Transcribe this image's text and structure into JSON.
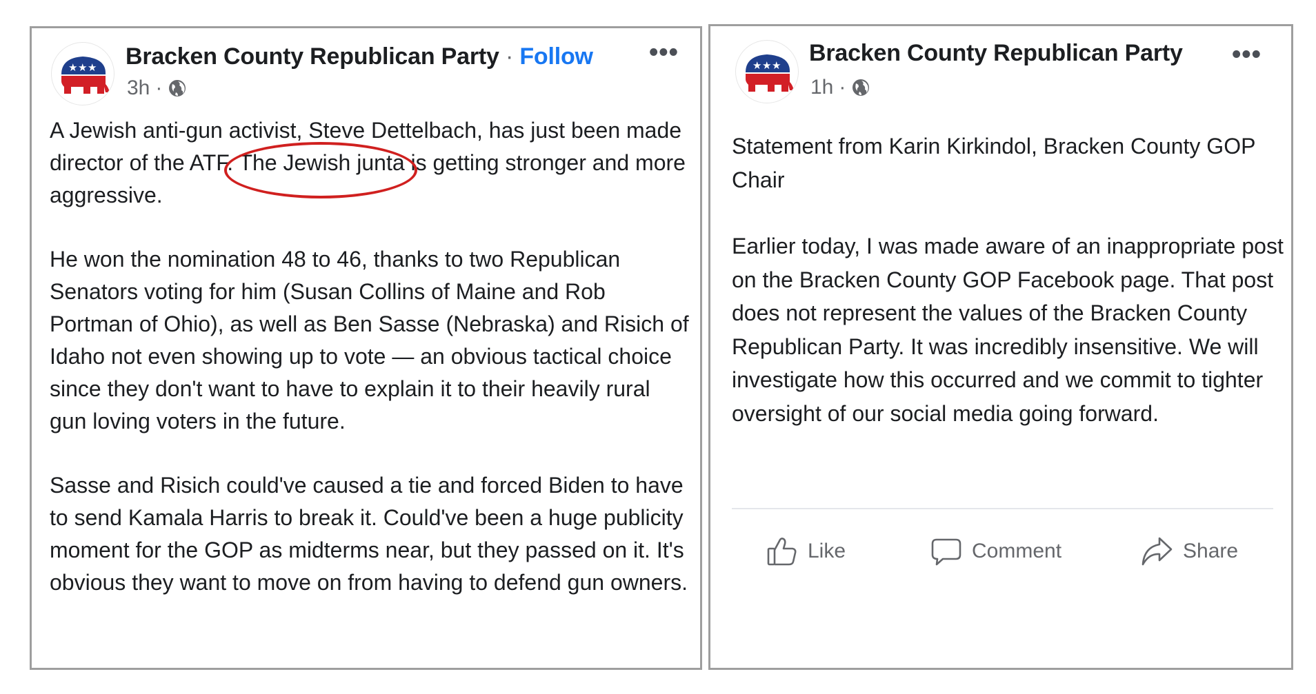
{
  "posts": [
    {
      "page_name": "Bracken County Republican Party",
      "separator": " · ",
      "follow_label": "Follow",
      "time": "3h",
      "meta_separator": "·",
      "more_label": "•••",
      "paragraphs": [
        {
          "before": "A Jewish anti-gun activist, Steve Dettelbach, has just been made director of the ATF.",
          "highlight": "The Jewish junta",
          "after": " is getting stronger and more aggressive."
        },
        {
          "text": "He won the nomination 48 to 46, thanks to two Republican Senators voting for him (Susan Collins of Maine and Rob Portman of Ohio), as well as Ben Sasse (Nebraska) and Risich of Idaho not even showing up to vote — an obvious tactical choice since they don't want to have to explain it to their heavily rural gun loving voters in the future."
        },
        {
          "text": "Sasse and Risich could've caused a tie and forced Biden to have to send Kamala Harris to break it. Could've been a huge publicity moment for the GOP as midterms near, but they passed on it. It's obvious they want to move on from having to defend gun owners."
        }
      ]
    },
    {
      "page_name": "Bracken County Republican Party",
      "time": "1h",
      "meta_separator": "·",
      "more_label": "•••",
      "paragraphs": [
        {
          "text": "Statement from Karin Kirkindol, Bracken County GOP Chair"
        },
        {
          "text": "Earlier today, I was made aware of an inappropriate post on the Bracken County GOP Facebook page. That post does not represent the values of the Bracken County Republican Party. It was incredibly insensitive. We will investigate how this occurred and we commit to tighter oversight of our social media going forward."
        }
      ],
      "actions": {
        "like": "Like",
        "comment": "Comment",
        "share": "Share"
      }
    }
  ],
  "colors": {
    "link_blue": "#1877f2",
    "circle_red": "#d0201f",
    "logo_blue": "#1f3f8c",
    "logo_red": "#d21f26",
    "text_dark": "#1c1e21",
    "text_muted": "#65676b"
  },
  "icons": {
    "logo": "gop-elephant-logo",
    "privacy": "globe-icon",
    "more": "more-options-icon",
    "like": "thumbs-up-icon",
    "comment": "comment-bubble-icon",
    "share": "share-arrow-icon"
  }
}
